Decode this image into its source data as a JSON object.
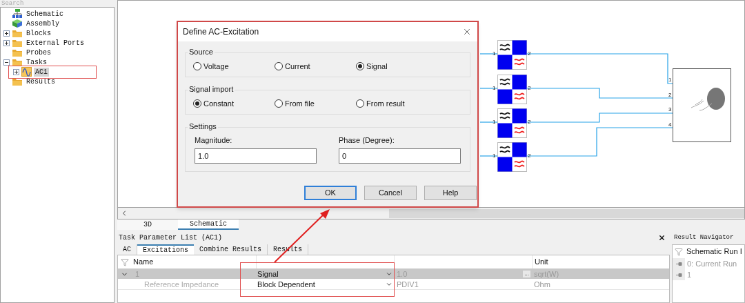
{
  "search_label": "Search",
  "tree": [
    {
      "label": "Schematic",
      "kind": "schematic",
      "selected": false
    },
    {
      "label": "Assembly",
      "kind": "assembly",
      "selected": false
    },
    {
      "label": "Blocks",
      "kind": "folder",
      "expanded": false,
      "selected": false
    },
    {
      "label": "External Ports",
      "kind": "folder",
      "expanded": false,
      "selected": false
    },
    {
      "label": "Probes",
      "kind": "folder",
      "selected": false
    },
    {
      "label": "Tasks",
      "kind": "folder",
      "expanded": true,
      "selected": false,
      "children": [
        {
          "label": "AC1",
          "kind": "task",
          "expanded": false,
          "selected": true
        }
      ]
    },
    {
      "label": "Results",
      "kind": "folder",
      "selected": false
    }
  ],
  "schematic": {
    "blocks": [
      {
        "pin_in": "1",
        "pin_out": "2"
      },
      {
        "pin_in": "1",
        "pin_out": "2"
      },
      {
        "pin_in": "1",
        "pin_out": "2"
      },
      {
        "pin_in": "1",
        "pin_out": "2"
      }
    ],
    "device_pins": [
      "1",
      "2",
      "3",
      "4"
    ]
  },
  "dialog": {
    "title": "Define AC-Excitation",
    "source": {
      "title": "Source",
      "options": [
        {
          "label": "Voltage",
          "selected": false
        },
        {
          "label": "Current",
          "selected": false
        },
        {
          "label": "Signal",
          "selected": true
        }
      ]
    },
    "signal_import": {
      "title": "Signal import",
      "options": [
        {
          "label": "Constant",
          "selected": true
        },
        {
          "label": "From file",
          "selected": false
        },
        {
          "label": "From result",
          "selected": false
        }
      ]
    },
    "settings": {
      "title": "Settings",
      "fields": [
        {
          "label": "Magnitude:",
          "value": "1.0"
        },
        {
          "label": "Phase (Degree):",
          "value": "0"
        }
      ]
    },
    "buttons": [
      {
        "label": "OK",
        "default": true
      },
      {
        "label": "Cancel",
        "default": false
      },
      {
        "label": "Help",
        "default": false
      }
    ]
  },
  "view_tabs": [
    {
      "label": "3D",
      "selected": false
    },
    {
      "label": "Schematic",
      "selected": true
    }
  ],
  "task_panel": {
    "title": "Task Parameter List (AC1)",
    "tabs": [
      {
        "label": "AC",
        "selected": false
      },
      {
        "label": "Excitations",
        "selected": true
      },
      {
        "label": "Combine Results",
        "selected": false
      },
      {
        "label": "Results",
        "selected": false
      }
    ],
    "columns": {
      "name": "Name",
      "unit": "Unit"
    },
    "rows": [
      {
        "name": "1",
        "expanded": true,
        "selected": true,
        "type": "Signal",
        "value": "1.0",
        "browse": "...",
        "unit": "sqrt(W)",
        "children": [
          {
            "name": "Reference Impedance",
            "type": "Block Dependent",
            "value": "PDIV1",
            "unit": "Ohm"
          }
        ]
      }
    ]
  },
  "result_navigator": {
    "title": "Result Navigator",
    "header": "Schematic Run I",
    "items": [
      "0: Current Run",
      "1"
    ]
  }
}
